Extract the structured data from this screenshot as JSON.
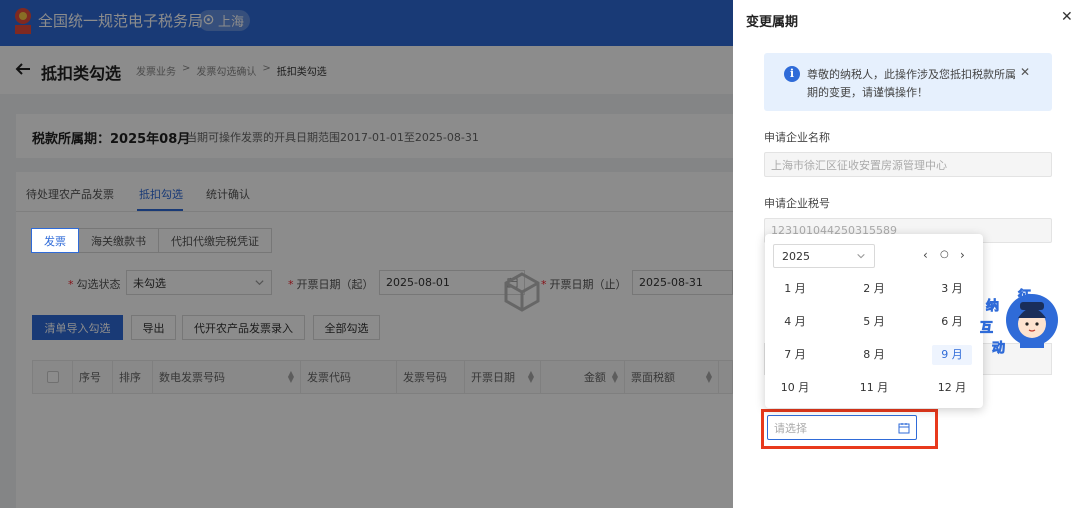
{
  "header": {
    "site_title": "全国统一规范电子税务局",
    "location": "上海",
    "brand_color": "#2f6bd8"
  },
  "page": {
    "title": "抵扣类勾选",
    "breadcrumb": [
      "发票业务",
      "发票勾选确认",
      "抵扣类勾选"
    ]
  },
  "period": {
    "label": "税款所属期：2025年08月",
    "note": "当期可操作发票的开具日期范围2017-01-01至2025-08-31"
  },
  "tabs": [
    {
      "label": "待处理农产品发票",
      "active": false
    },
    {
      "label": "抵扣勾选",
      "active": true
    },
    {
      "label": "统计确认",
      "active": false
    }
  ],
  "segments": [
    {
      "label": "发票",
      "active": true
    },
    {
      "label": "海关缴款书",
      "active": false
    },
    {
      "label": "代扣代缴完税凭证",
      "active": false
    }
  ],
  "filters": {
    "status_label": "勾选状态",
    "status_value": "未勾选",
    "start_label": "开票日期（起）",
    "start_value": "2025-08-01",
    "end_label": "开票日期（止）",
    "end_value": "2025-08-31"
  },
  "actions": {
    "import": "清单导入勾选",
    "export": "导出",
    "agri_entry": "代开农产品发票录入",
    "select_all": "全部勾选"
  },
  "table": {
    "columns": [
      "序号",
      "排序",
      "数电发票号码",
      "发票代码",
      "发票号码",
      "开票日期",
      "金额",
      "票面税额"
    ]
  },
  "drawer": {
    "title": "变更属期",
    "alert": "尊敬的纳税人，此操作涉及您抵扣税款所属期的变更，请谨慎操作！",
    "company_name_label": "申请企业名称",
    "company_name_value": "上海市徐汇区征收安置房源管理中心",
    "tax_id_label": "申请企业税号",
    "tax_id_value": "123101044250315589",
    "period_placeholder": "请选择"
  },
  "month_picker": {
    "year": "2025",
    "months": [
      "1 月",
      "2 月",
      "3 月",
      "4 月",
      "5 月",
      "6 月",
      "7 月",
      "8 月",
      "9 月",
      "10 月",
      "11 月",
      "12 月"
    ],
    "selected_month": "9 月"
  },
  "mascot": {
    "chars": [
      "征",
      "纳",
      "互",
      "动"
    ]
  }
}
